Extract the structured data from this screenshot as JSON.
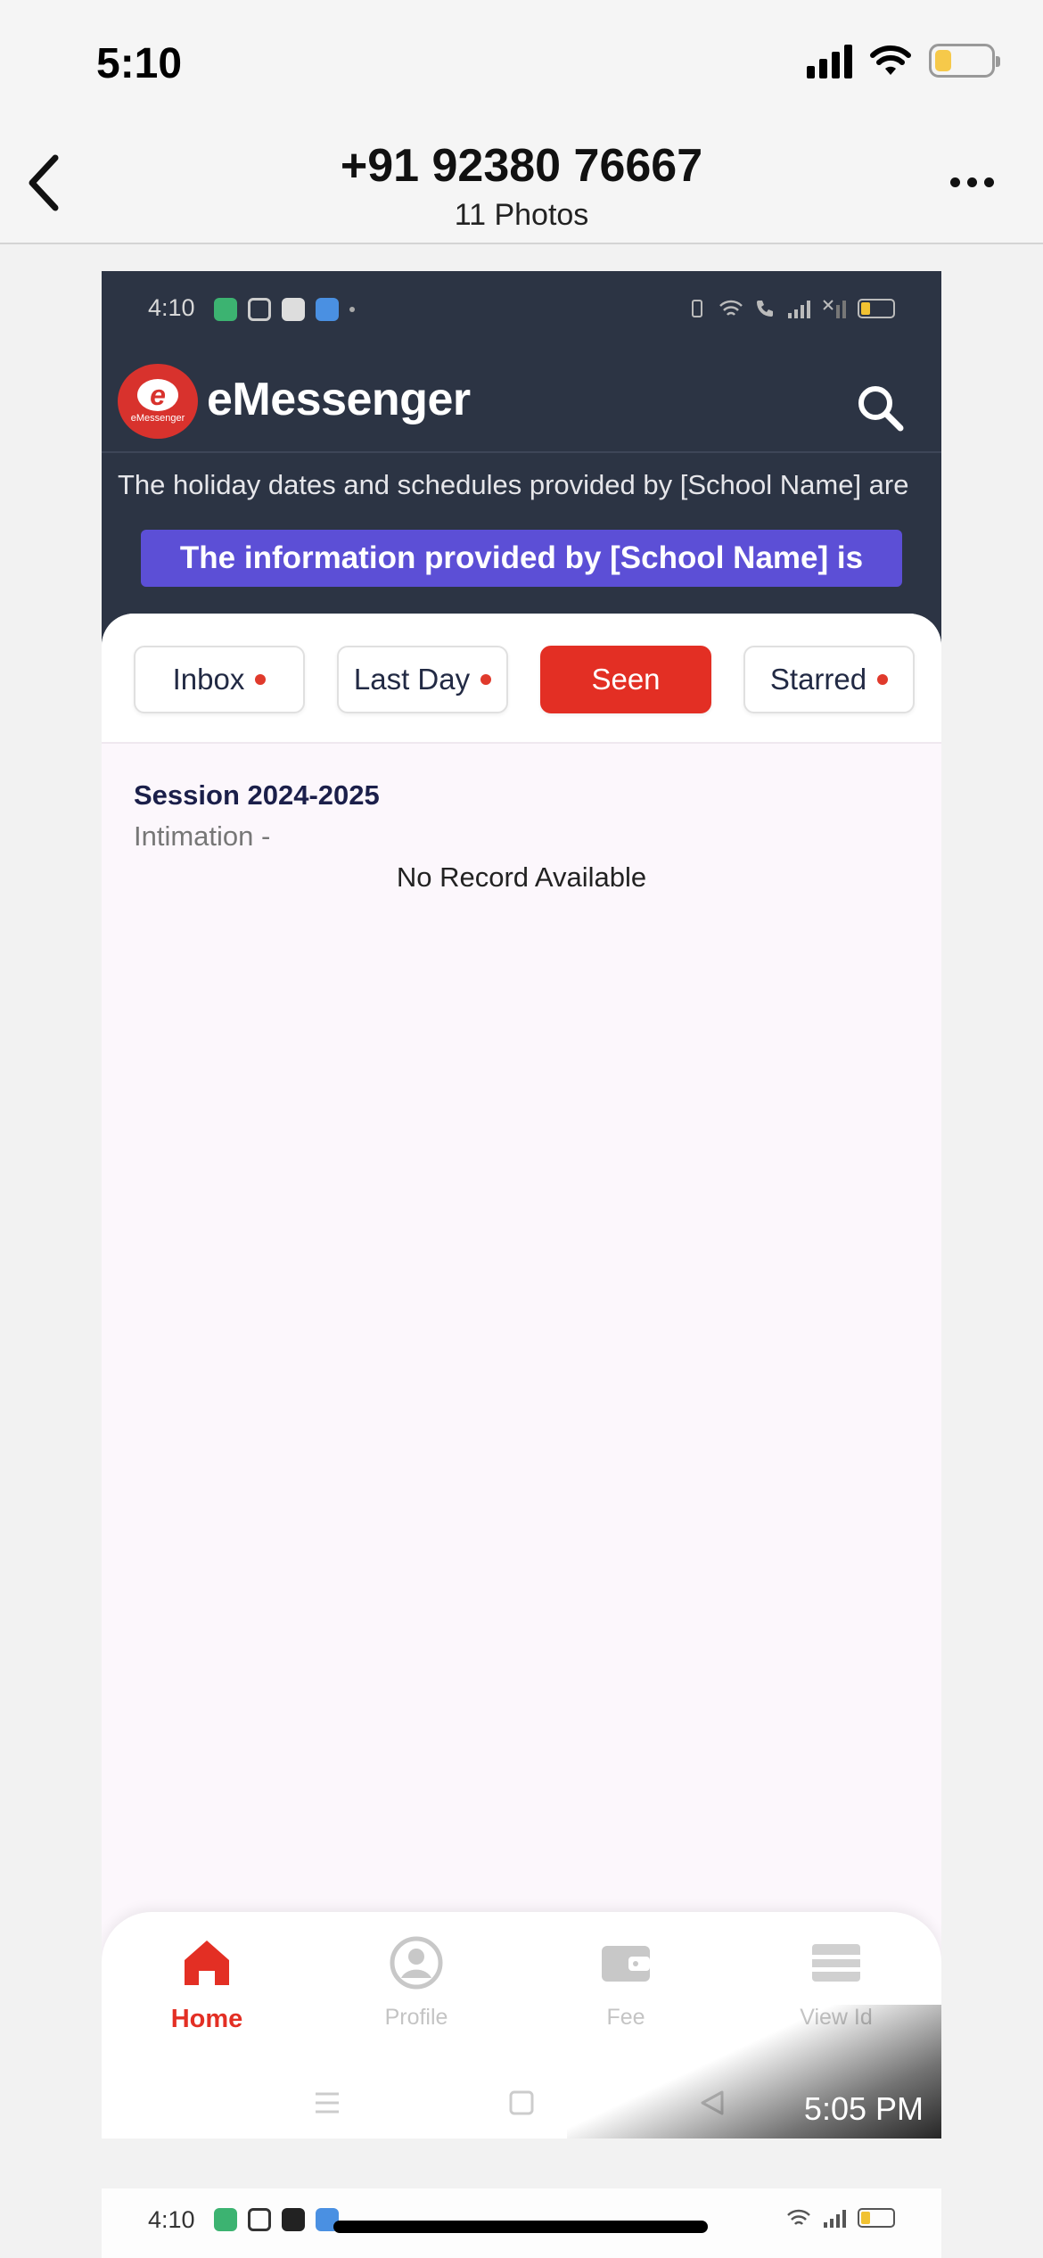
{
  "ios_status": {
    "time": "5:10"
  },
  "header": {
    "title": "+91 92380 76667",
    "subtitle": "11 Photos"
  },
  "shot": {
    "android_status": {
      "time": "4:10"
    },
    "app": {
      "name": "eMessenger",
      "logo_letter": "e",
      "logo_word": "eMessenger"
    },
    "ticker": "The holiday dates and schedules provided by [School Name] are",
    "notice": "The information provided by [School Name] is",
    "tabs": [
      {
        "label": "Inbox",
        "dot": true
      },
      {
        "label": "Last Day",
        "dot": true
      },
      {
        "label": "Seen",
        "dot": false,
        "active": true
      },
      {
        "label": "Starred",
        "dot": true
      }
    ],
    "session": "Session 2024-2025",
    "intimation": "Intimation -",
    "empty_message": "No Record Available",
    "nav": [
      {
        "label": "Home",
        "icon": "home-icon",
        "active": true
      },
      {
        "label": "Profile",
        "icon": "profile-icon"
      },
      {
        "label": "Fee",
        "icon": "wallet-icon"
      },
      {
        "label": "View Id",
        "icon": "id-card-icon"
      }
    ],
    "timestamp": "5:05 PM"
  },
  "next_shot": {
    "time": "4:10"
  },
  "colors": {
    "accent": "#e32f24",
    "dark_bg": "#2c3444",
    "notice_bg": "#5c4fd6"
  }
}
